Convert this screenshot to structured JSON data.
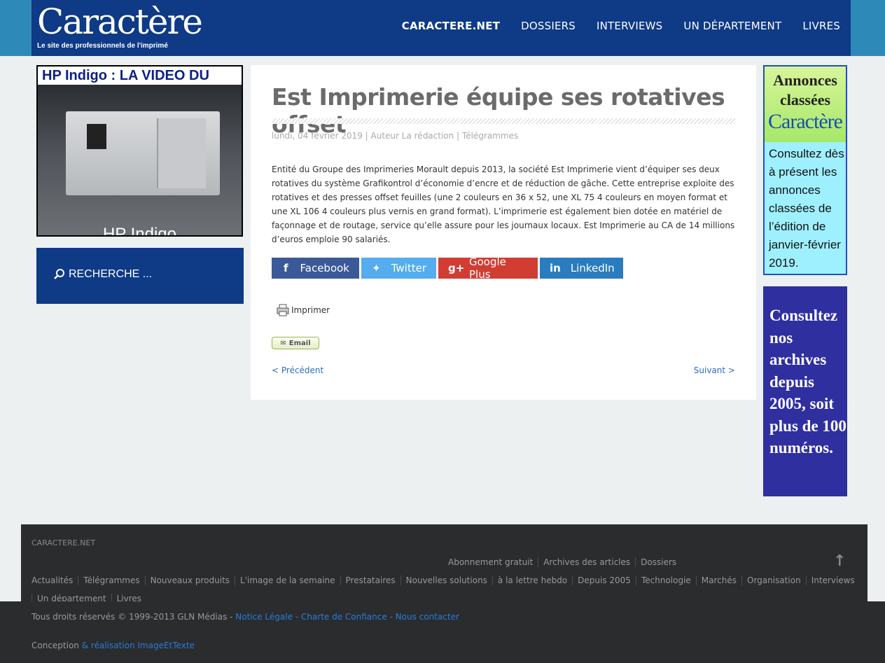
{
  "header": {
    "logo": "Caractère",
    "tagline": "Le site des professionnels de l'imprimé",
    "nav": [
      "CARACTERE.NET",
      "DOSSIERS",
      "INTERVIEWS",
      "UN DÉPARTEMENT",
      "LIVRES"
    ]
  },
  "sidebar": {
    "video_title": "HP Indigo : LA VIDEO DU MOIS",
    "video_caption": "HP Indigo",
    "search_label": "RECHERCHE ..."
  },
  "article": {
    "title": "Est Imprimerie équipe ses rotatives offset",
    "meta": "lundi, 04 février 2019 | Auteur La rédaction | Télégrammes",
    "body": "Entité du Groupe des Imprimeries Morault depuis 2013, la société Est Imprimerie vient d’équiper ses deux rotatives du système Grafikontrol d’économie d’encre et de réduction de gâche. Cette entreprise exploite des rotatives et des presses offset feuilles (une 2 couleurs en 36 x 52, une XL 75 4 couleurs en moyen format et une XL 106 4 couleurs plus vernis en grand format). L’imprimerie est également bien dotée en matériel de façonnage et de routage, service qu’elle assure pour les journaux locaux. Est Imprimerie au CA de 14 millions d’euros emploie 90 salariés.",
    "share": {
      "facebook": "Facebook",
      "twitter": "Twitter",
      "googleplus": "Google Plus",
      "linkedin": "LinkedIn"
    },
    "print": "Imprimer",
    "email": "Email",
    "prev": "< Précédent",
    "next": "Suivant >"
  },
  "ads": {
    "classified_head1": "Annonces classées",
    "classified_head2": "Caractère",
    "classified_text": "Consultez dès à présent les annonces classées de l’édition de janvier-février 2019.",
    "archives_text": "Consultez nos archives depuis 2005, soit plus de 100 numéros."
  },
  "footer": {
    "site": "CARACTERE.NET",
    "links_row1": [
      "Actualités",
      "Télégrammes",
      "Nouveaux produits",
      "L'image de la semaine",
      "Prestataires",
      "Nouvelles solutions",
      "à la lettre hebdo",
      "Depuis 2005",
      "Technologie",
      "Marchés",
      "Organisation",
      "Interviews"
    ],
    "links_top": [
      "Abonnement gratuit",
      "Archives des articles",
      "Dossiers"
    ],
    "links_row2": [
      "Un département",
      "Livres"
    ],
    "copyright": "Tous droits réservés © 1999-2013 GLN Médias - ",
    "legal_links": "Notice Légale - Charte de Confiance - Nous contacter",
    "conception": "Conception ",
    "realisation": "& réalisation ",
    "agency": "ImageEtTexte"
  }
}
